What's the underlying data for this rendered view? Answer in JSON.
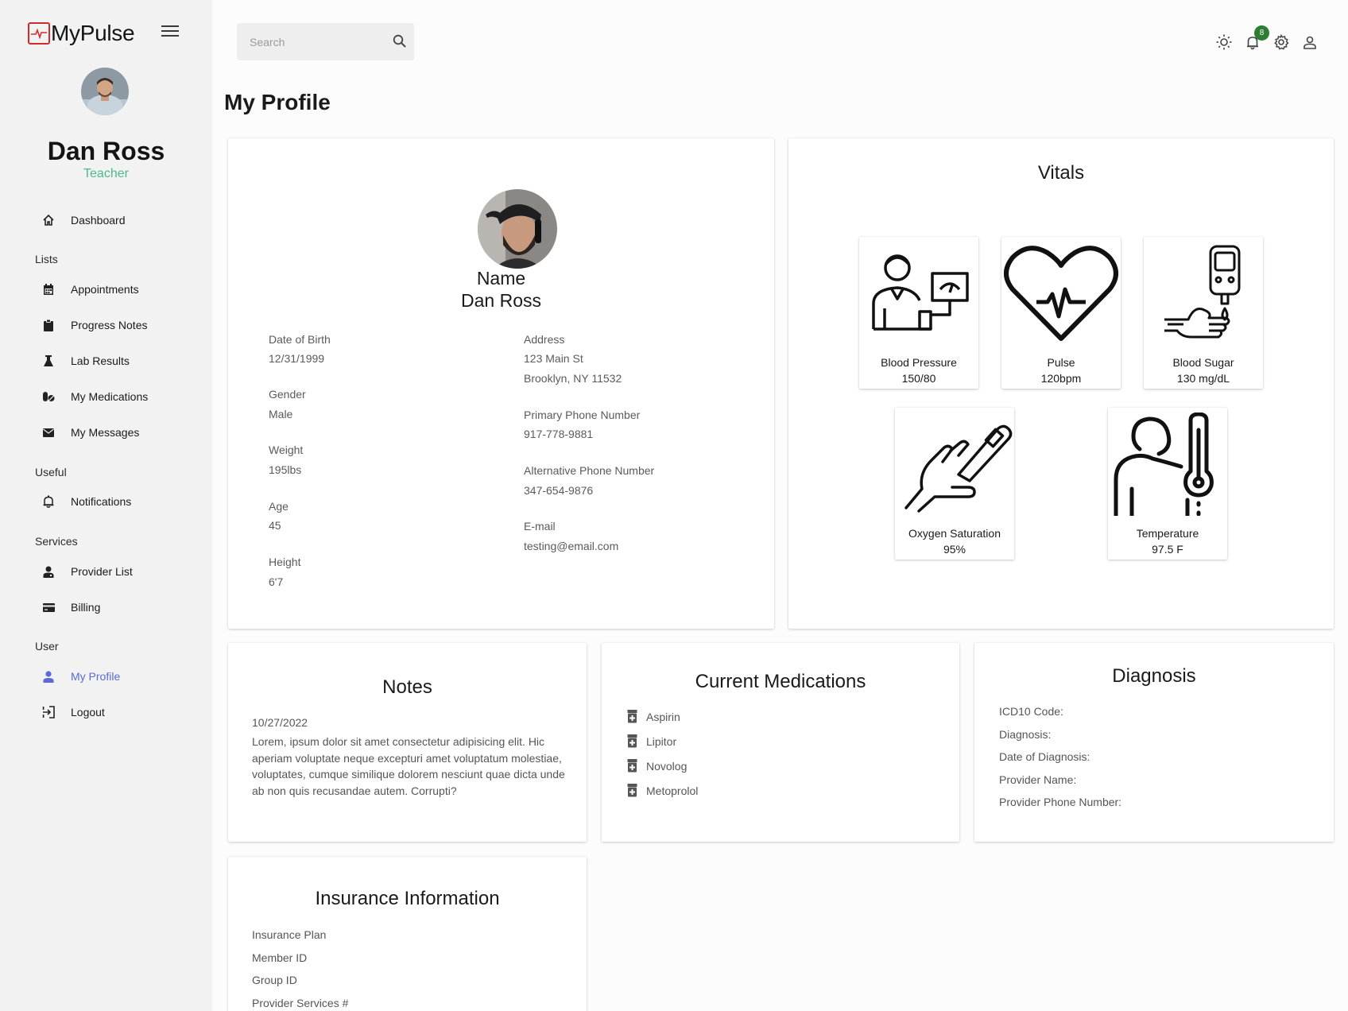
{
  "app": {
    "name": "MyPulse",
    "accent": "#5b6ad6",
    "role_color": "#4cb88c",
    "logo_color": "#d22b2b"
  },
  "user": {
    "name": "Dan Ross",
    "role": "Teacher"
  },
  "nav": {
    "dashboard": "Dashboard",
    "section_lists": "Lists",
    "appointments": "Appointments",
    "progress_notes": "Progress Notes",
    "lab_results": "Lab Results",
    "my_medications": "My Medications",
    "my_messages": "My Messages",
    "section_useful": "Useful",
    "notifications": "Notifications",
    "section_services": "Services",
    "provider_list": "Provider List",
    "billing": "Billing",
    "section_user": "User",
    "my_profile": "My Profile",
    "logout": "Logout"
  },
  "header": {
    "search_placeholder": "Search",
    "notification_count": "8"
  },
  "page": {
    "title": "My Profile"
  },
  "profile": {
    "name_label": "Name",
    "name": "Dan Ross",
    "dob_label": "Date of Birth",
    "dob": "12/31/1999",
    "gender_label": "Gender",
    "gender": "Male",
    "weight_label": "Weight",
    "weight": "195lbs",
    "age_label": "Age",
    "age": "45",
    "height_label": "Height",
    "height": "6'7",
    "address_label": "Address",
    "address_line1": "123 Main St",
    "address_line2": "Brooklyn, NY 11532",
    "primary_phone_label": "Primary Phone Number",
    "primary_phone": "917-778-9881",
    "alt_phone_label": "Alternative Phone Number",
    "alt_phone": "347-654-9876",
    "email_label": "E-mail",
    "email": "testing@email.com"
  },
  "vitals": {
    "title": "Vitals",
    "blood_pressure": {
      "label": "Blood Pressure",
      "value": "150/80"
    },
    "pulse": {
      "label": "Pulse",
      "value": "120bpm"
    },
    "blood_sugar": {
      "label": "Blood Sugar",
      "value": "130 mg/dL"
    },
    "oxygen": {
      "label": "Oxygen Saturation",
      "value": "95%"
    },
    "temperature": {
      "label": "Temperature",
      "value": "97.5 F"
    }
  },
  "notes": {
    "title": "Notes",
    "date": "10/27/2022",
    "body": "Lorem, ipsum dolor sit amet consectetur adipisicing elit. Hic aperiam voluptate neque excepturi amet voluptatum molestiae, voluptates, cumque similique dolorem nesciunt quae dicta unde ab non quis recusandae autem. Corrupti?"
  },
  "medications": {
    "title": "Current Medications",
    "items": [
      "Aspirin",
      "Lipitor",
      "Novolog",
      "Metoprolol"
    ]
  },
  "diagnosis": {
    "title": "Diagnosis",
    "icd10": "ICD10 Code:",
    "diagnosis": "Diagnosis:",
    "date": "Date of Diagnosis:",
    "provider_name": "Provider Name:",
    "provider_phone": "Provider Phone Number:"
  },
  "insurance": {
    "title": "Insurance Information",
    "plan": "Insurance Plan",
    "member_id": "Member ID",
    "group_id": "Group ID",
    "provider_services": "Provider Services #"
  }
}
